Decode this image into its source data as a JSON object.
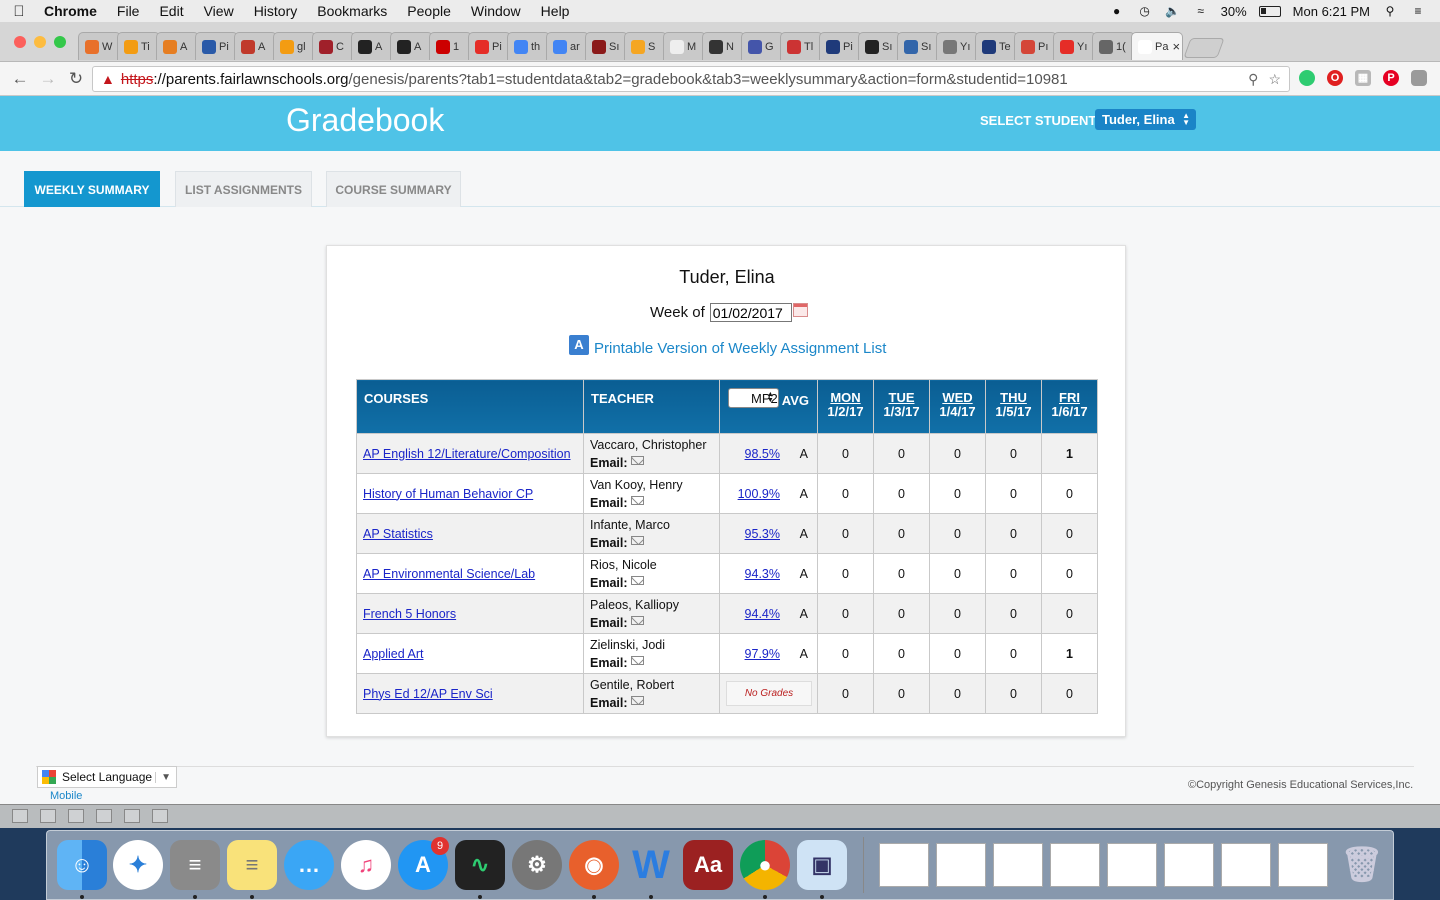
{
  "menubar": {
    "app_name": "Chrome",
    "items": [
      "File",
      "Edit",
      "View",
      "History",
      "Bookmarks",
      "People",
      "Window",
      "Help"
    ],
    "battery": "30%",
    "clock": "Mon 6:21 PM"
  },
  "browser": {
    "tabs": [
      {
        "label": "W",
        "color": "#e8702a"
      },
      {
        "label": "Ti",
        "color": "#f39c12"
      },
      {
        "label": "A",
        "color": "#e67e22"
      },
      {
        "label": "Pi",
        "color": "#2a5aa8"
      },
      {
        "label": "A",
        "color": "#c0392b"
      },
      {
        "label": "gl",
        "color": "#f39c12"
      },
      {
        "label": "C",
        "color": "#a0202a"
      },
      {
        "label": "A",
        "color": "#222222"
      },
      {
        "label": "A",
        "color": "#222222"
      },
      {
        "label": "1",
        "color": "#cc0000"
      },
      {
        "label": "Pi",
        "color": "#e52d27"
      },
      {
        "label": "th",
        "color": "#4285f4"
      },
      {
        "label": "ar",
        "color": "#4285f4"
      },
      {
        "label": "Sı",
        "color": "#8b1a1a"
      },
      {
        "label": "S",
        "color": "#f5a623"
      },
      {
        "label": "M",
        "color": "#eeeeee"
      },
      {
        "label": "N",
        "color": "#333333"
      },
      {
        "label": "G",
        "color": "#4455aa"
      },
      {
        "label": "Tl",
        "color": "#cc3333"
      },
      {
        "label": "Pi",
        "color": "#1f3a7a"
      },
      {
        "label": "Sı",
        "color": "#222222"
      },
      {
        "label": "Sı",
        "color": "#3366aa"
      },
      {
        "label": "Yı",
        "color": "#777777"
      },
      {
        "label": "Te",
        "color": "#1f3a7a"
      },
      {
        "label": "Pı",
        "color": "#d44638"
      },
      {
        "label": "Yı",
        "color": "#e52d27"
      },
      {
        "label": "1(",
        "color": "#666666"
      },
      {
        "label": "Pa",
        "color": "#ffffff"
      }
    ],
    "url_scheme": "https",
    "url_host": "://parents.fairlawnschools.org",
    "url_path": "/genesis/parents?tab1=studentdata&tab2=gradebook&tab3=weeklysummary&action=form&studentid=10981"
  },
  "page": {
    "banner_title": "Gradebook",
    "select_student_label": "SELECT STUDENT:",
    "selected_student": "Tuder, Elina",
    "tabs": [
      "WEEKLY SUMMARY",
      "LIST ASSIGNMENTS",
      "COURSE SUMMARY"
    ],
    "student_name": "Tuder, Elina",
    "week_of_label": "Week of",
    "week_of_value": "01/02/2017",
    "printable_link": "Printable Version of Weekly Assignment List",
    "table": {
      "headers": {
        "courses": "COURSES",
        "teacher": "TEACHER",
        "mp_value": "MP2",
        "avg": "AVG"
      },
      "days": [
        {
          "name": "MON",
          "date": "1/2/17"
        },
        {
          "name": "TUE",
          "date": "1/3/17"
        },
        {
          "name": "WED",
          "date": "1/4/17"
        },
        {
          "name": "THU",
          "date": "1/5/17"
        },
        {
          "name": "FRI",
          "date": "1/6/17"
        }
      ],
      "email_label": "Email:",
      "rows": [
        {
          "course": "AP English 12/Literature/Composition",
          "teacher": "Vaccaro, Christopher",
          "avg": "98.5%",
          "letter": "A",
          "counts": [
            "0",
            "0",
            "0",
            "0",
            "1"
          ]
        },
        {
          "course": "History of Human Behavior CP",
          "teacher": "Van Kooy, Henry",
          "avg": "100.9%",
          "letter": "A",
          "counts": [
            "0",
            "0",
            "0",
            "0",
            "0"
          ]
        },
        {
          "course": "AP Statistics",
          "teacher": "Infante, Marco",
          "avg": "95.3%",
          "letter": "A",
          "counts": [
            "0",
            "0",
            "0",
            "0",
            "0"
          ]
        },
        {
          "course": "AP Environmental Science/Lab",
          "teacher": "Rios, Nicole",
          "avg": "94.3%",
          "letter": "A",
          "counts": [
            "0",
            "0",
            "0",
            "0",
            "0"
          ]
        },
        {
          "course": "French 5 Honors",
          "teacher": "Paleos, Kalliopy",
          "avg": "94.4%",
          "letter": "A",
          "counts": [
            "0",
            "0",
            "0",
            "0",
            "0"
          ]
        },
        {
          "course": "Applied Art",
          "teacher": "Zielinski, Jodi",
          "avg": "97.9%",
          "letter": "A",
          "counts": [
            "0",
            "0",
            "0",
            "0",
            "1"
          ]
        },
        {
          "course": "Phys Ed 12/AP Env Sci",
          "teacher": "Gentile, Robert",
          "avg": "",
          "letter": "",
          "no_grades": "No Grades",
          "counts": [
            "0",
            "0",
            "0",
            "0",
            "0"
          ]
        }
      ]
    },
    "footer": {
      "select_language": "Select Language",
      "mobile": "Mobile",
      "copyright": "©Copyright Genesis Educational Services,Inc."
    }
  },
  "dock": {
    "app_store_badge": "9",
    "apps": [
      "Finder",
      "Safari",
      "Calculator",
      "Notes",
      "Messages",
      "iTunes",
      "App Store",
      "Activity Monitor",
      "System Preferences",
      "Firefox",
      "Word",
      "Dictionary",
      "Chrome",
      "Preview"
    ]
  }
}
